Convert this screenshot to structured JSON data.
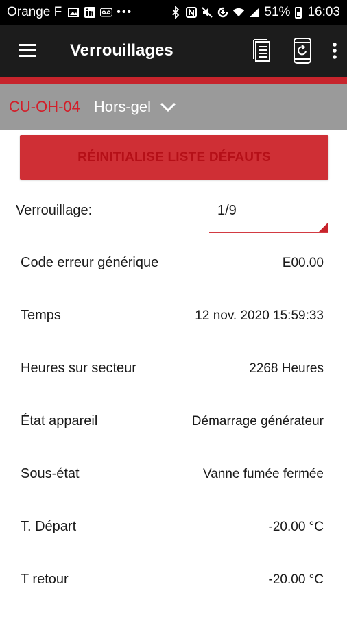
{
  "status_bar": {
    "carrier": "Orange F",
    "left_icons": [
      "image-icon",
      "linkedin-icon",
      "voicemail-icon",
      "more-notifications-icon"
    ],
    "right_icons": [
      "bluetooth-icon",
      "nfc-icon",
      "mute-icon",
      "data-saver-icon",
      "wifi-icon",
      "signal-icon"
    ],
    "battery": "51%",
    "time": "16:03"
  },
  "app_bar": {
    "title": "Verrouillages",
    "actions": [
      "document-icon",
      "phone-refresh-icon",
      "more-vertical-icon"
    ]
  },
  "device": {
    "id": "CU-OH-04",
    "mode": "Hors-gel"
  },
  "reset_button": {
    "label": "RÉINITIALISE LISTE DÉFAUTS"
  },
  "lock": {
    "label": "Verrouillage:",
    "value": "1/9"
  },
  "rows": [
    {
      "label": "Code erreur générique",
      "value": "E00.00"
    },
    {
      "label": "Temps",
      "value": "12 nov. 2020 15:59:33"
    },
    {
      "label": "Heures sur secteur",
      "value": "2268 Heures"
    },
    {
      "label": "État appareil",
      "value": "Démarrage générateur"
    },
    {
      "label": "Sous-état",
      "value": "Vanne fumée fermée"
    },
    {
      "label": "T. Départ",
      "value": "-20.00 °C"
    },
    {
      "label": "T retour",
      "value": "-20.00 °C"
    }
  ],
  "colors": {
    "app_bar": "#1c1c1c",
    "accent_red": "#c7242c",
    "device_bar": "#9a9a9a",
    "button_bg": "#cf2f35",
    "button_text": "#b50f17"
  }
}
